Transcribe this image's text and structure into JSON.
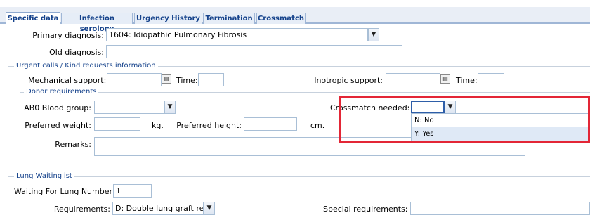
{
  "tabs": [
    "Specific data",
    "Infection serology",
    "Urgency History",
    "Termination",
    "Crossmatch"
  ],
  "primary_diagnosis": {
    "label": "Primary diagnosis:",
    "value": "1604: Idiopathic Pulmonary Fibrosis"
  },
  "old_diagnosis": {
    "label": "Old diagnosis:",
    "value": ""
  },
  "urgent": {
    "legend": "Urgent calls / Kind requests information",
    "mechanical_label": "Mechanical support:",
    "time_label": "Time:",
    "inotropic_label": "Inotropic support:",
    "time2_label": "Time:"
  },
  "donor": {
    "legend": "Donor requirements",
    "abo_label": "AB0 Blood group:",
    "crossmatch_label": "Crossmatch needed:",
    "weight_label": "Preferred weight:",
    "weight_unit": "kg.",
    "height_label": "Preferred height:",
    "height_unit": "cm.",
    "remarks_label": "Remarks:",
    "crossmatch_options": [
      "N: No",
      "Y: Yes"
    ]
  },
  "lung": {
    "legend": "Lung Waitinglist",
    "number_label": "Waiting For Lung Number:",
    "number_value": "1",
    "req_label": "Requirements:",
    "req_value": "D: Double lung graft requir",
    "special_label": "Special requirements:"
  },
  "icons": {
    "dropdown": "chevron-down-icon",
    "calendar": "calendar-icon"
  },
  "colors": {
    "tab_text": "#15428b",
    "highlight_box": "#e32636",
    "selected_option": "#dfe9f6"
  }
}
